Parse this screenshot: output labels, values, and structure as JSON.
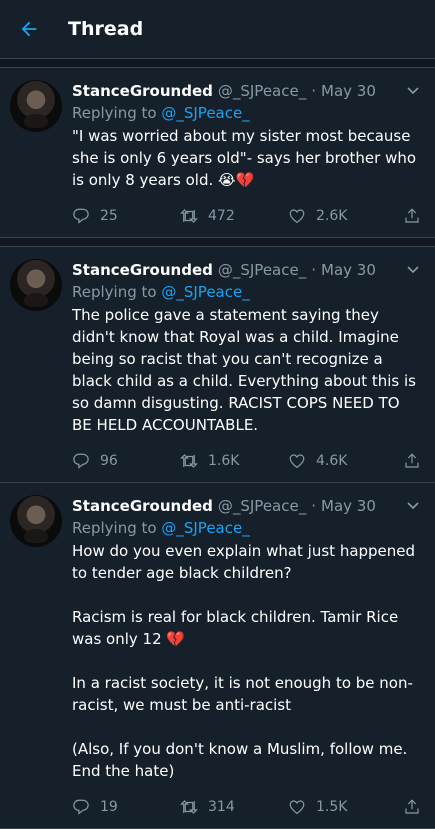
{
  "header": {
    "title": "Thread"
  },
  "tweets": [
    {
      "name": "StanceGrounded",
      "handle": "@_SJPeace_",
      "dot": "·",
      "date": "May 30",
      "reply_prefix": "Replying to",
      "reply_handle": "@_SJPeace_",
      "text": "\"I was worried about my sister most because she is only 6 years old\"- says her brother who is only 8 years old. 😭💔",
      "replies": "25",
      "retweets": "472",
      "likes": "2.6K"
    },
    {
      "name": "StanceGrounded",
      "handle": "@_SJPeace_",
      "dot": "·",
      "date": "May 30",
      "reply_prefix": "Replying to",
      "reply_handle": "@_SJPeace_",
      "text": "The police gave a statement saying they didn't know that Royal was a child. Imagine being so racist that you can't recognize a black child as a child. Everything about this is so damn disgusting. RACIST COPS NEED TO BE HELD ACCOUNTABLE.",
      "replies": "96",
      "retweets": "1.6K",
      "likes": "4.6K"
    },
    {
      "name": "StanceGrounded",
      "handle": "@_SJPeace_",
      "dot": "·",
      "date": "May 30",
      "reply_prefix": "Replying to",
      "reply_handle": "@_SJPeace_",
      "text": "How do you even explain what just happened to tender age black children?\n\nRacism is real for black children. Tamir Rice was only 12 💔\n\nIn a racist society, it is not enough to be non-racist, we must be anti-racist\n\n(Also, If you don't know a Muslim, follow me. End the hate)",
      "replies": "19",
      "retweets": "314",
      "likes": "1.5K"
    }
  ],
  "colors": {
    "accent": "#1da1f2",
    "background": "#15202b",
    "muted": "#8899a6"
  },
  "icons": [
    "back-arrow-icon",
    "caret-down-icon",
    "reply-icon",
    "retweet-icon",
    "like-icon",
    "share-icon"
  ]
}
